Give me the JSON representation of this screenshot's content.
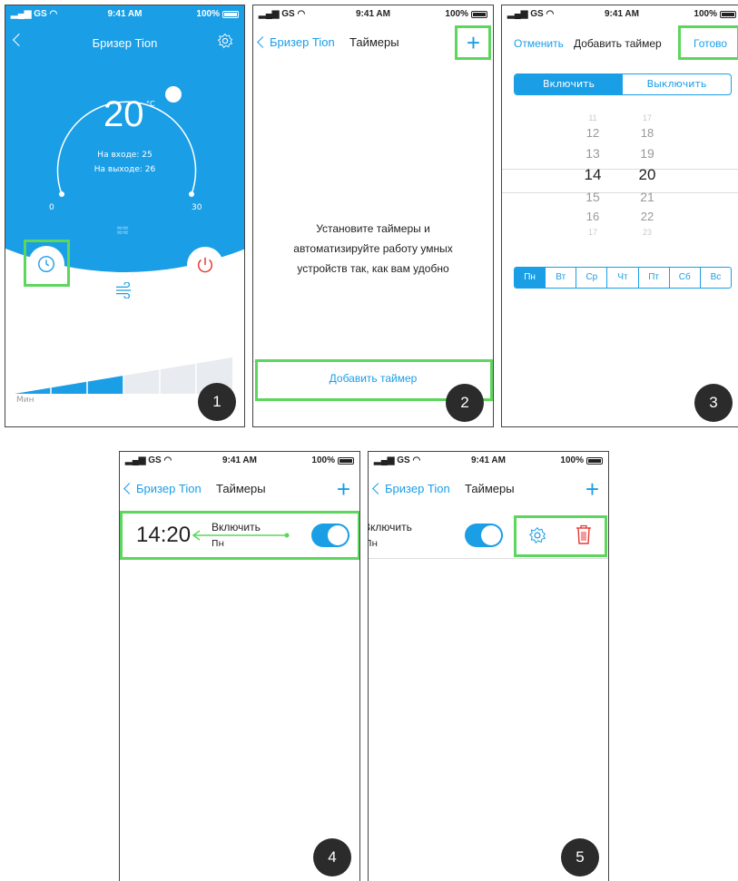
{
  "status": {
    "carrier": "GS",
    "time": "9:41 AM",
    "battery": "100%"
  },
  "p1": {
    "title": "Бризер Tion",
    "temp": "20",
    "temp_unit": "°C",
    "inlet": "На входе: 25",
    "outlet": "На выходе: 26",
    "min": "0",
    "max": "30",
    "speed_min_label": "Мин",
    "badge": "1"
  },
  "p2": {
    "back": "Бризер Tion",
    "title": "Таймеры",
    "empty_text": "Установите таймеры и автоматизируйте работу умных устройств так, как вам удобно",
    "add_button": "Добавить таймер",
    "badge": "2"
  },
  "p3": {
    "cancel": "Отменить",
    "title": "Добавить таймер",
    "done": "Готово",
    "seg_on": "Включить",
    "seg_off": "Выключить",
    "hours": [
      "11",
      "12",
      "13",
      "14",
      "15",
      "16",
      "17"
    ],
    "minutes": [
      "17",
      "18",
      "19",
      "20",
      "21",
      "22",
      "23"
    ],
    "days": [
      "Пн",
      "Вт",
      "Ср",
      "Чт",
      "Пт",
      "Сб",
      "Вс"
    ],
    "badge": "3"
  },
  "p4": {
    "back": "Бризер Tion",
    "title": "Таймеры",
    "time": "14:20",
    "action": "Включить",
    "day": "Пн",
    "badge": "4"
  },
  "p5": {
    "back": "Бризер Tion",
    "title": "Таймеры",
    "action": "Включить",
    "day": "Пн",
    "badge": "5"
  },
  "colors": {
    "accent": "#1a9ee6",
    "highlight": "#5cd65c",
    "danger": "#e53935"
  }
}
